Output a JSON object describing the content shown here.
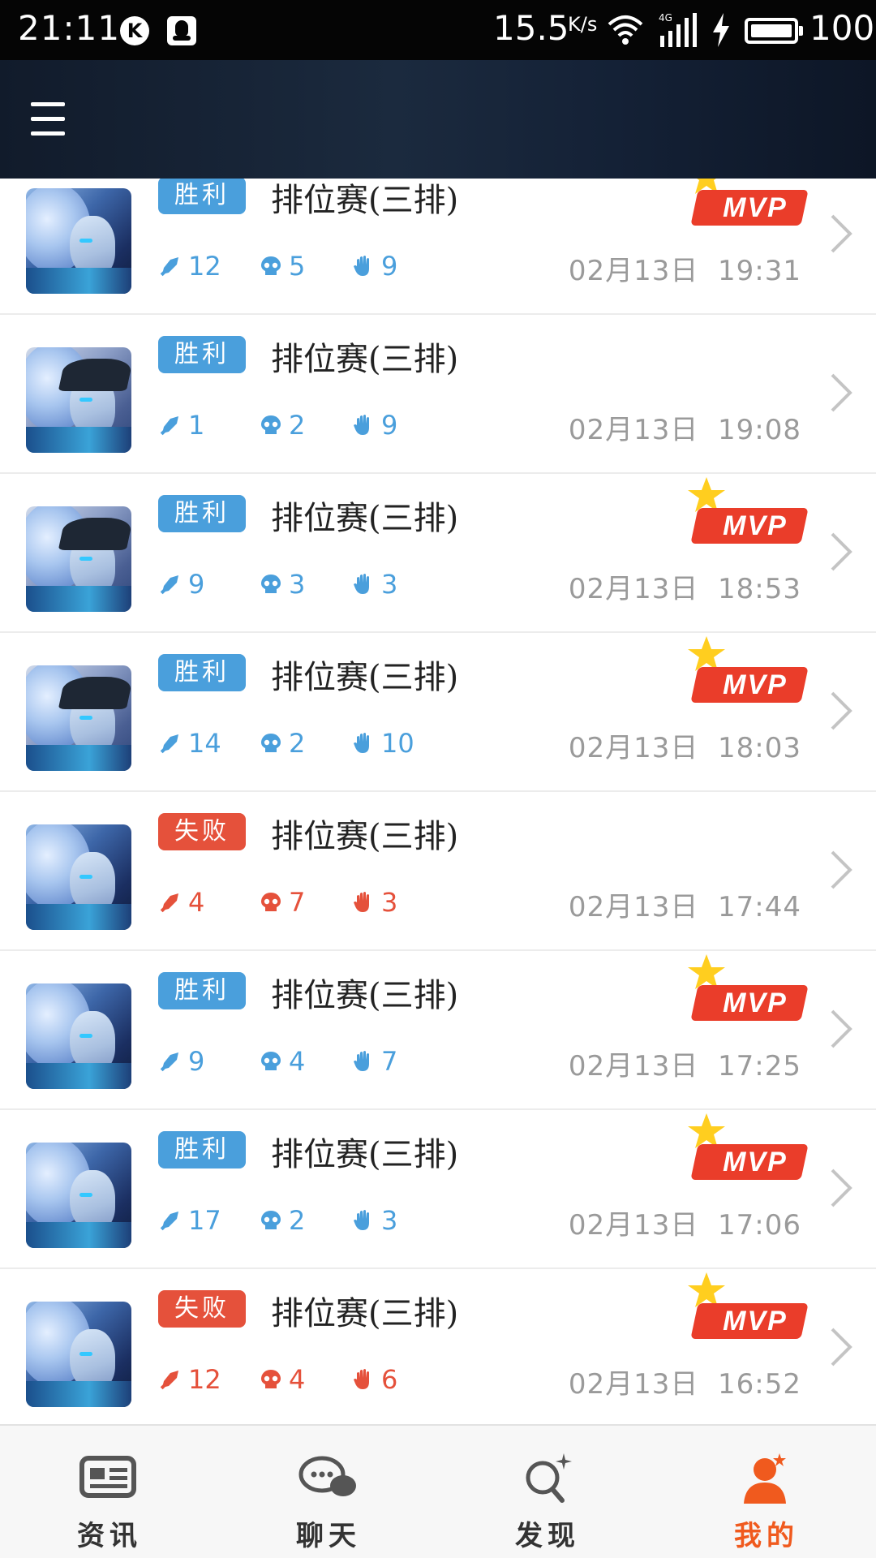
{
  "status_bar": {
    "time": "21:11",
    "net_speed": "15.5",
    "net_unit": "K/s",
    "network_type": "4G",
    "battery_level": "100",
    "icons": [
      "k-app-icon",
      "qq-icon",
      "wifi-icon",
      "signal-icon",
      "charging-icon",
      "battery-icon"
    ]
  },
  "header": {
    "menu_icon": "hamburger-menu-icon"
  },
  "colors": {
    "win": "#4a9fdc",
    "lose": "#e5513b",
    "mvp": "#ea3d2a",
    "active_nav": "#f05a1e"
  },
  "matches": [
    {
      "result": "胜利",
      "outcome": "win",
      "mode": "排位赛(三排)",
      "kills": "12",
      "deaths": "5",
      "assists": "9",
      "date": "02月13日",
      "time": "19:31",
      "mvp": true,
      "hero": "hero-a"
    },
    {
      "result": "胜利",
      "outcome": "win",
      "mode": "排位赛(三排)",
      "kills": "1",
      "deaths": "2",
      "assists": "9",
      "date": "02月13日",
      "time": "19:08",
      "mvp": false,
      "hero": "hero-b"
    },
    {
      "result": "胜利",
      "outcome": "win",
      "mode": "排位赛(三排)",
      "kills": "9",
      "deaths": "3",
      "assists": "3",
      "date": "02月13日",
      "time": "18:53",
      "mvp": true,
      "hero": "hero-b"
    },
    {
      "result": "胜利",
      "outcome": "win",
      "mode": "排位赛(三排)",
      "kills": "14",
      "deaths": "2",
      "assists": "10",
      "date": "02月13日",
      "time": "18:03",
      "mvp": true,
      "hero": "hero-b"
    },
    {
      "result": "失败",
      "outcome": "lose",
      "mode": "排位赛(三排)",
      "kills": "4",
      "deaths": "7",
      "assists": "3",
      "date": "02月13日",
      "time": "17:44",
      "mvp": false,
      "hero": "hero-a"
    },
    {
      "result": "胜利",
      "outcome": "win",
      "mode": "排位赛(三排)",
      "kills": "9",
      "deaths": "4",
      "assists": "7",
      "date": "02月13日",
      "time": "17:25",
      "mvp": true,
      "hero": "hero-a"
    },
    {
      "result": "胜利",
      "outcome": "win",
      "mode": "排位赛(三排)",
      "kills": "17",
      "deaths": "2",
      "assists": "3",
      "date": "02月13日",
      "time": "17:06",
      "mvp": true,
      "hero": "hero-a"
    },
    {
      "result": "失败",
      "outcome": "lose",
      "mode": "排位赛(三排)",
      "kills": "12",
      "deaths": "4",
      "assists": "6",
      "date": "02月13日",
      "time": "16:52",
      "mvp": true,
      "hero": "hero-a"
    }
  ],
  "mvp_label": "MVP",
  "bottom_nav": [
    {
      "label": "资讯",
      "icon": "news-icon",
      "active": false
    },
    {
      "label": "聊天",
      "icon": "chat-icon",
      "active": false
    },
    {
      "label": "发现",
      "icon": "discover-icon",
      "active": false
    },
    {
      "label": "我的",
      "icon": "profile-icon",
      "active": true
    }
  ]
}
